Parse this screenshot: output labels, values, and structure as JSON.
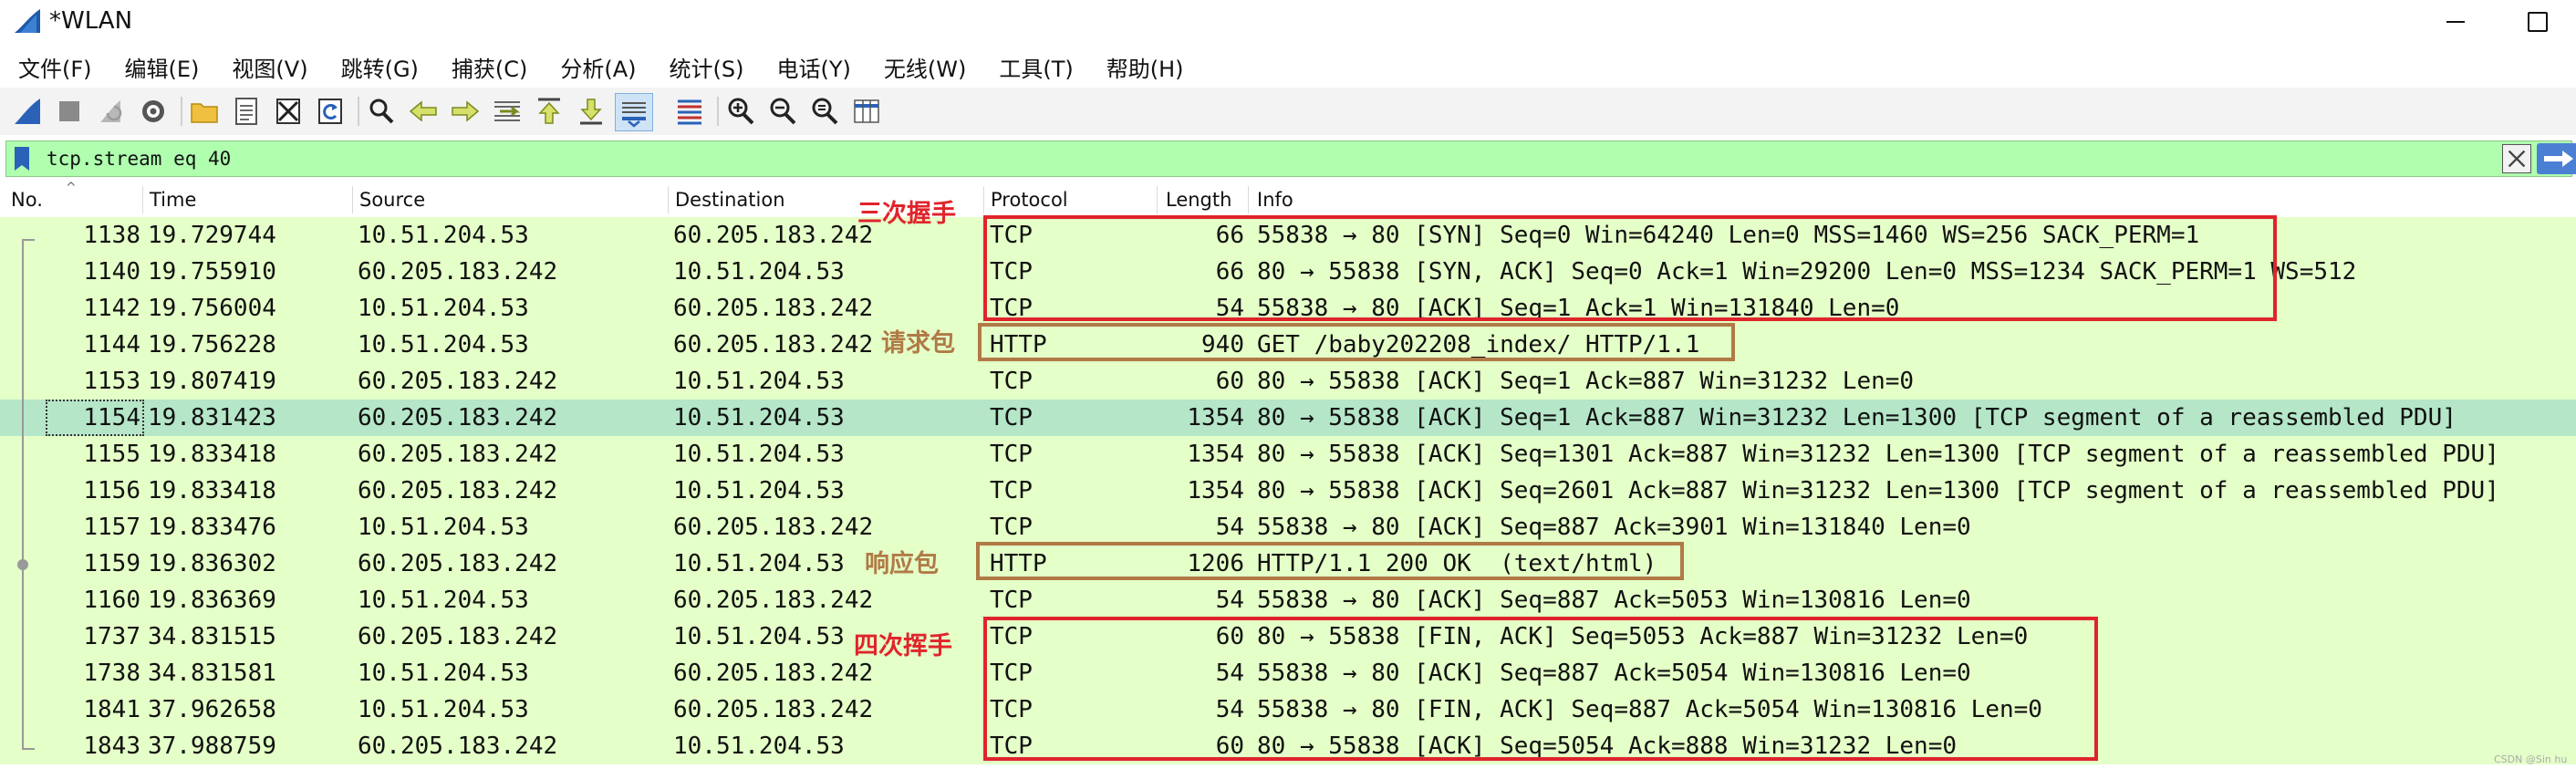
{
  "window": {
    "title": "*WLAN"
  },
  "menu": [
    "文件(F)",
    "编辑(E)",
    "视图(V)",
    "跳转(G)",
    "捕获(C)",
    "分析(A)",
    "统计(S)",
    "电话(Y)",
    "无线(W)",
    "工具(T)",
    "帮助(H)"
  ],
  "toolbar": {
    "icons": [
      "start-capture-icon",
      "stop-capture-icon",
      "restart-capture-icon",
      "capture-options-icon",
      "open-file-icon",
      "save-file-icon",
      "close-file-icon",
      "reload-file-icon",
      "find-packet-icon",
      "go-back-icon",
      "go-forward-icon",
      "go-to-packet-icon",
      "first-packet-icon",
      "last-packet-icon",
      "autoscroll-icon",
      "colorize-icon",
      "zoom-in-icon",
      "zoom-out-icon",
      "normal-size-icon",
      "resize-columns-icon"
    ]
  },
  "filter": {
    "value": "tcp.stream eq 40"
  },
  "columns": {
    "no": "No.",
    "time": "Time",
    "source": "Source",
    "destination": "Destination",
    "protocol": "Protocol",
    "length": "Length",
    "info": "Info"
  },
  "packets": [
    {
      "no": "1138",
      "time": "19.729744",
      "source": "10.51.204.53",
      "destination": "60.205.183.242",
      "protocol": "TCP",
      "length": "66",
      "info": "55838 → 80 [SYN] Seq=0 Win=64240 Len=0 MSS=1460 WS=256 SACK_PERM=1"
    },
    {
      "no": "1140",
      "time": "19.755910",
      "source": "60.205.183.242",
      "destination": "10.51.204.53",
      "protocol": "TCP",
      "length": "66",
      "info": "80 → 55838 [SYN, ACK] Seq=0 Ack=1 Win=29200 Len=0 MSS=1234 SACK_PERM=1 WS=512"
    },
    {
      "no": "1142",
      "time": "19.756004",
      "source": "10.51.204.53",
      "destination": "60.205.183.242",
      "protocol": "TCP",
      "length": "54",
      "info": "55838 → 80 [ACK] Seq=1 Ack=1 Win=131840 Len=0"
    },
    {
      "no": "1144",
      "time": "19.756228",
      "source": "10.51.204.53",
      "destination": "60.205.183.242",
      "protocol": "HTTP",
      "length": "940",
      "info": "GET /baby202208_index/ HTTP/1.1"
    },
    {
      "no": "1153",
      "time": "19.807419",
      "source": "60.205.183.242",
      "destination": "10.51.204.53",
      "protocol": "TCP",
      "length": "60",
      "info": "80 → 55838 [ACK] Seq=1 Ack=887 Win=31232 Len=0"
    },
    {
      "no": "1154",
      "time": "19.831423",
      "source": "60.205.183.242",
      "destination": "10.51.204.53",
      "protocol": "TCP",
      "length": "1354",
      "info": "80 → 55838 [ACK] Seq=1 Ack=887 Win=31232 Len=1300 [TCP segment of a reassembled PDU]"
    },
    {
      "no": "1155",
      "time": "19.833418",
      "source": "60.205.183.242",
      "destination": "10.51.204.53",
      "protocol": "TCP",
      "length": "1354",
      "info": "80 → 55838 [ACK] Seq=1301 Ack=887 Win=31232 Len=1300 [TCP segment of a reassembled PDU]"
    },
    {
      "no": "1156",
      "time": "19.833418",
      "source": "60.205.183.242",
      "destination": "10.51.204.53",
      "protocol": "TCP",
      "length": "1354",
      "info": "80 → 55838 [ACK] Seq=2601 Ack=887 Win=31232 Len=1300 [TCP segment of a reassembled PDU]"
    },
    {
      "no": "1157",
      "time": "19.833476",
      "source": "10.51.204.53",
      "destination": "60.205.183.242",
      "protocol": "TCP",
      "length": "54",
      "info": "55838 → 80 [ACK] Seq=887 Ack=3901 Win=131840 Len=0"
    },
    {
      "no": "1159",
      "time": "19.836302",
      "source": "60.205.183.242",
      "destination": "10.51.204.53",
      "protocol": "HTTP",
      "length": "1206",
      "info": "HTTP/1.1 200 OK  (text/html)"
    },
    {
      "no": "1160",
      "time": "19.836369",
      "source": "10.51.204.53",
      "destination": "60.205.183.242",
      "protocol": "TCP",
      "length": "54",
      "info": "55838 → 80 [ACK] Seq=887 Ack=5053 Win=130816 Len=0"
    },
    {
      "no": "1737",
      "time": "34.831515",
      "source": "60.205.183.242",
      "destination": "10.51.204.53",
      "protocol": "TCP",
      "length": "60",
      "info": "80 → 55838 [FIN, ACK] Seq=5053 Ack=887 Win=31232 Len=0"
    },
    {
      "no": "1738",
      "time": "34.831581",
      "source": "10.51.204.53",
      "destination": "60.205.183.242",
      "protocol": "TCP",
      "length": "54",
      "info": "55838 → 80 [ACK] Seq=887 Ack=5054 Win=130816 Len=0"
    },
    {
      "no": "1841",
      "time": "37.962658",
      "source": "10.51.204.53",
      "destination": "60.205.183.242",
      "protocol": "TCP",
      "length": "54",
      "info": "55838 → 80 [FIN, ACK] Seq=887 Ack=5054 Win=130816 Len=0"
    },
    {
      "no": "1843",
      "time": "37.988759",
      "source": "60.205.183.242",
      "destination": "10.51.204.53",
      "protocol": "TCP",
      "length": "60",
      "info": "80 → 55838 [ACK] Seq=5054 Ack=888 Win=31232 Len=0"
    }
  ],
  "selected_packet": "1154",
  "annotations": {
    "handshake": "三次握手",
    "request": "请求包",
    "response": "响应包",
    "teardown": "四次挥手"
  },
  "colors": {
    "row_bg": "#e4ffc7",
    "selected_bg": "#b5e6c8",
    "filter_bg": "#afffaf",
    "annotation_red": "#e0242c",
    "annotation_brown": "#b07a46"
  },
  "watermark": "CSDN @Sin hu"
}
